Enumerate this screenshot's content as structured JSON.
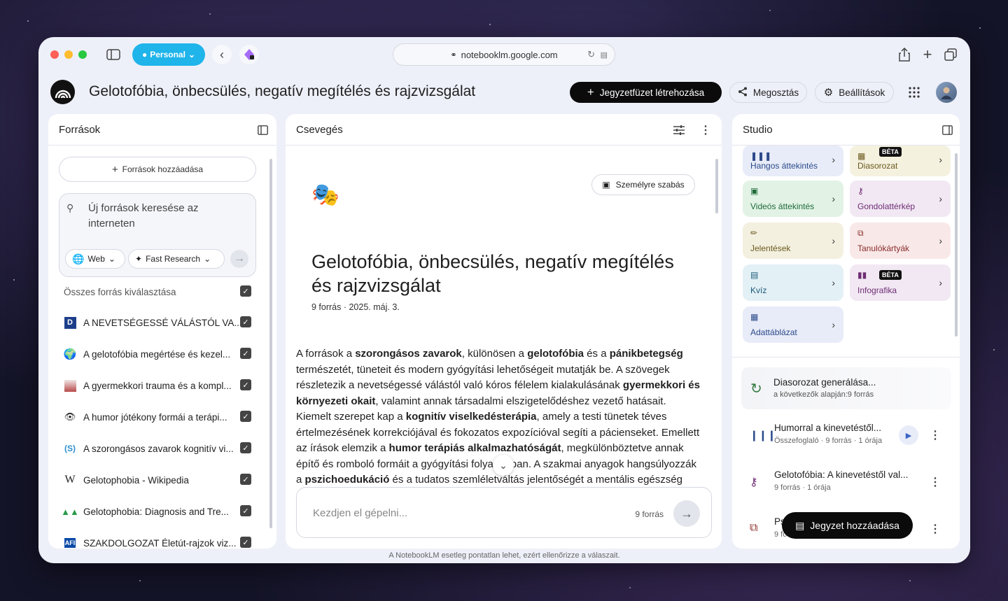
{
  "browser": {
    "profile_label": "Personal",
    "url": "notebooklm.google.com"
  },
  "header": {
    "title": "Gelotofóbia, önbecsülés, negatív megítélés és rajzvizsgálat",
    "create_label": "Jegyzetfüzet létrehozása",
    "share_label": "Megosztás",
    "settings_label": "Beállítások"
  },
  "sources": {
    "heading": "Források",
    "add_label": "Források hozzáadása",
    "search_placeholder": "Új források keresése az interneten",
    "web_label": "Web",
    "research_label": "Fast Research",
    "select_all_label": "Összes forrás kiválasztása",
    "items": [
      {
        "label": "A NEVETSÉGESSÉ VÁLÁSTÓL VA...",
        "icon": "D"
      },
      {
        "label": "A gelotofóbia megértése és kezel...",
        "icon": "globe"
      },
      {
        "label": "A gyermekkori trauma és a kompl...",
        "icon": "photo"
      },
      {
        "label": "A humor jótékony formái a terápi...",
        "icon": "eye"
      },
      {
        "label": "A szorongásos zavarok kognitív vi...",
        "icon": "S"
      },
      {
        "label": "Gelotophobia - Wikipedia",
        "icon": "W"
      },
      {
        "label": "Gelotophobia: Diagnosis and Tre...",
        "icon": "figures"
      },
      {
        "label": "SZAKDOLGOZAT Életút-rajzok viz...",
        "icon": "AFI"
      }
    ]
  },
  "chat": {
    "heading": "Csevegés",
    "customize_label": "Személyre szabás",
    "title_line1": "Gelotofóbia, önbecsülés, negatív megítélés",
    "title_line2": "és rajzvizsgálat",
    "meta": "9 forrás · 2025. máj. 3.",
    "summary_lines": [
      [
        {
          "t": "A források a "
        },
        {
          "t": "szorongásos zavarok",
          "b": true
        },
        {
          "t": ", különösen a "
        },
        {
          "t": "gelotofóbia",
          "b": true
        },
        {
          "t": " és a "
        },
        {
          "t": "pánikbetegség",
          "b": true
        }
      ],
      [
        {
          "t": "természetét, tüneteit és modern gyógyítási lehetőségeit mutatják be. A szövegek"
        }
      ],
      [
        {
          "t": "részletezik a nevetségessé válástól való kóros félelem kialakulásának "
        },
        {
          "t": "gyermekkori és",
          "b": true
        }
      ],
      [
        {
          "t": "környezeti okait",
          "b": true
        },
        {
          "t": ", valamint annak társadalmi elszigetelődéshez vezető hatásait."
        }
      ],
      [
        {
          "t": "Kiemelt szerepet kap a "
        },
        {
          "t": "kognitív viselkedésterápia",
          "b": true
        },
        {
          "t": ", amely a testi tünetek téves"
        }
      ],
      [
        {
          "t": "értelmezésének korrekciójával és fokozatos expozícióval segíti a pácienseket. Emellett"
        }
      ],
      [
        {
          "t": "az írások elemzik a "
        },
        {
          "t": "humor terápiás alkalmazhatóságát",
          "b": true
        },
        {
          "t": ", megkülönböztetve annak"
        }
      ],
      [
        {
          "t": "építő és romboló formáit a gyógyítási folyamatban. A szakmai anyagok hangsúlyozzák"
        }
      ],
      [
        {
          "t": "a "
        },
        {
          "t": "pszichoedukáció",
          "b": true
        },
        {
          "t": " és a tudatos szemléletváltás jelentőségét a mentális egészség"
        }
      ]
    ],
    "input_placeholder": "Kezdjen el gépelni...",
    "source_count": "9 forrás",
    "disclaimer": "A NotebookLM esetleg pontatlan lehet, ezért ellenőrizze a válaszait."
  },
  "studio": {
    "heading": "Studio",
    "cards": [
      {
        "label": "Hangos áttekintés",
        "color": "#e8ecf8",
        "text": "#2b4a8a"
      },
      {
        "label": "Diasorozat",
        "color": "#f5f1df",
        "text": "#6b5a1e",
        "beta": "BÉTA"
      },
      {
        "label": "Videós áttekintés",
        "color": "#e2f3e6",
        "text": "#1f6b38"
      },
      {
        "label": "Gondolattérkép",
        "color": "#f1e8f3",
        "text": "#6e2c74"
      },
      {
        "label": "Jelentések",
        "color": "#f3f0e0",
        "text": "#6b5a1e"
      },
      {
        "label": "Tanulókártyák",
        "color": "#f8e9e8",
        "text": "#8a2c2a"
      },
      {
        "label": "Kvíz",
        "color": "#e3f0f6",
        "text": "#1d5a7a"
      },
      {
        "label": "Infografika",
        "color": "#f1e8f3",
        "text": "#6e2c74",
        "beta": "BÉTA"
      },
      {
        "label": "Adattáblázat",
        "color": "#e8ecf8",
        "text": "#2b4a8a"
      }
    ],
    "generating_title": "Diasorozat generálása...",
    "generating_sub": "a következők alapján:9 forrás",
    "items": [
      {
        "title": "Humorral a kinevetéstől...",
        "sub": "Összefoglaló · 9 forrás · 1 órája"
      },
      {
        "title": "Gelotofóbia: A kinevetéstől val...",
        "sub": "9 forrás · 1 órája"
      },
      {
        "title": "Ps",
        "sub": "9 fo"
      }
    ],
    "add_note_label": "Jegyzet hozzáadása"
  }
}
